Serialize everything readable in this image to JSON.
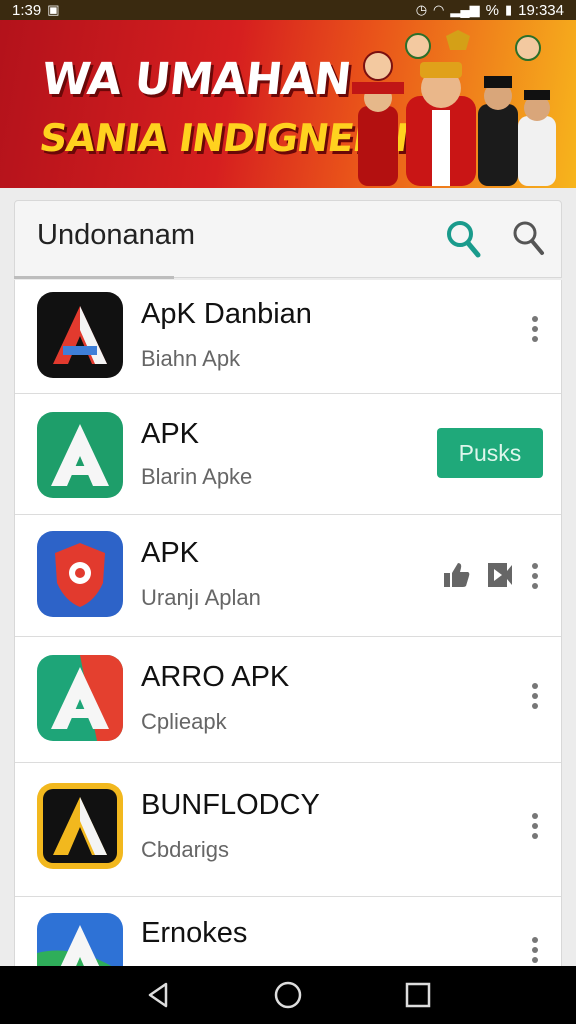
{
  "status_bar": {
    "time_left": "1:39",
    "time_right": "19:334",
    "battery_pct": "%"
  },
  "banner": {
    "line1": "WA UMAHAN",
    "line2": "SANIA INDIGNEIAI"
  },
  "search": {
    "text": "Undonanam"
  },
  "apps": [
    {
      "name": "ApK Danbian",
      "subtitle": "Biahn Apk",
      "icon": "apk-a-black-icon"
    },
    {
      "name": "APK",
      "subtitle": "Blarin Apke",
      "icon": "apk-a-green-icon",
      "button": "Pusks"
    },
    {
      "name": "APK",
      "subtitle": "Uranjı Aplan",
      "icon": "shield-target-icon"
    },
    {
      "name": "ARRO APK",
      "subtitle": "Cplieapk",
      "icon": "apk-a-teal-icon"
    },
    {
      "name": "BUNFLODCY",
      "subtitle": "Cbdarigs",
      "icon": "apk-a-yellow-icon"
    },
    {
      "name": "Ernokes",
      "subtitle": "",
      "icon": "apk-a-blue-icon"
    }
  ],
  "colors": {
    "accent_green": "#1fa97a",
    "search_teal": "#1a9b8c"
  }
}
